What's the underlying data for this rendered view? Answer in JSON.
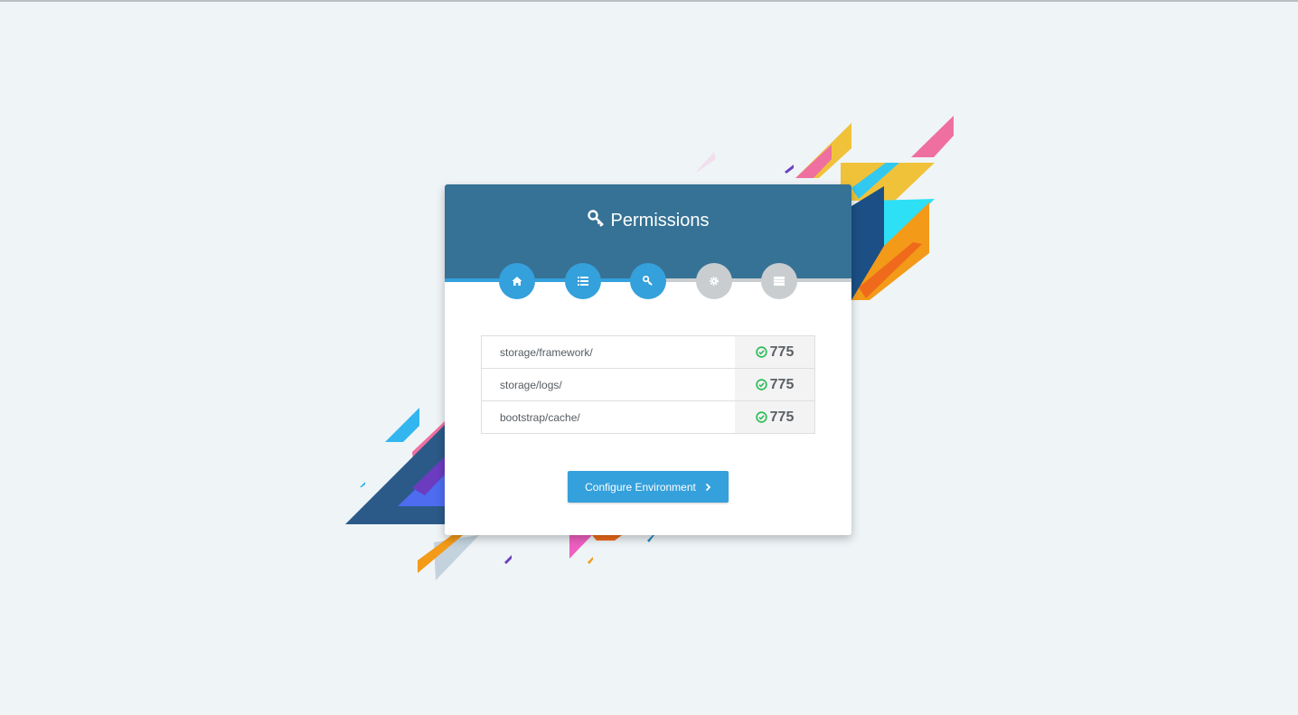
{
  "header": {
    "title": "Permissions",
    "title_icon": "key-icon"
  },
  "steps": [
    {
      "name": "home",
      "icon": "home-icon",
      "state": "done"
    },
    {
      "name": "requirements",
      "icon": "list-icon",
      "state": "done"
    },
    {
      "name": "permissions",
      "icon": "key-icon",
      "state": "current"
    },
    {
      "name": "environment",
      "icon": "gear-icon",
      "state": "todo"
    },
    {
      "name": "final",
      "icon": "server-icon",
      "state": "todo"
    }
  ],
  "permissions": [
    {
      "path": "storage/framework/",
      "value": "775",
      "status": "ok"
    },
    {
      "path": "storage/logs/",
      "value": "775",
      "status": "ok"
    },
    {
      "path": "bootstrap/cache/",
      "value": "775",
      "status": "ok"
    }
  ],
  "action": {
    "label": "Configure Environment",
    "icon": "chevron-right-icon"
  },
  "colors": {
    "header": "#367295",
    "accent": "#34a0dc",
    "success": "#2ebd59",
    "inactive": "#c9cdd0",
    "background": "#eff4f7"
  }
}
